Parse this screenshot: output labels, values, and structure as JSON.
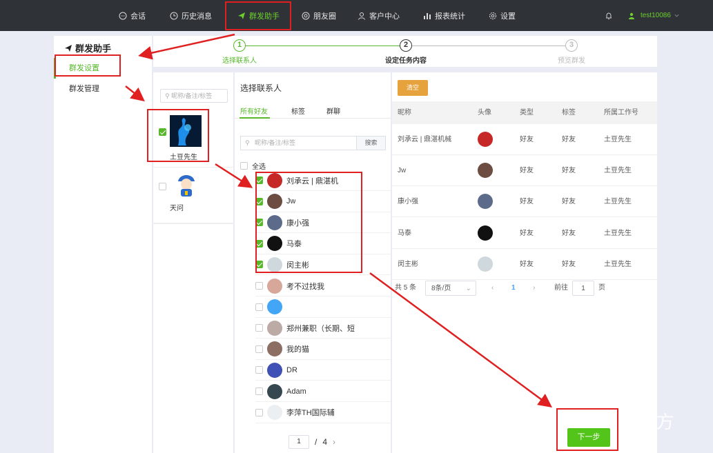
{
  "topnav": {
    "items": [
      {
        "label": "会话",
        "icon": "chat-icon"
      },
      {
        "label": "历史消息",
        "icon": "clock-icon"
      },
      {
        "label": "群发助手",
        "icon": "send-icon",
        "active": true
      },
      {
        "label": "朋友圈",
        "icon": "moments-icon"
      },
      {
        "label": "客户中心",
        "icon": "user-icon"
      },
      {
        "label": "报表统计",
        "icon": "bar-chart-icon"
      },
      {
        "label": "设置",
        "icon": "gear-icon"
      }
    ],
    "username": "test10086"
  },
  "sidebar": {
    "title": "群发助手",
    "items": [
      {
        "label": "群发设置",
        "active": true
      },
      {
        "label": "群发管理"
      }
    ]
  },
  "steps": [
    {
      "num": "1",
      "label": "选择联系人",
      "state": "done"
    },
    {
      "num": "2",
      "label": "设定任务内容",
      "state": "current"
    },
    {
      "num": "3",
      "label": "预览群发",
      "state": "pending"
    }
  ],
  "accounts": {
    "search_placeholder": "昵称/备注/标签",
    "items": [
      {
        "name": "土豆先生",
        "checked": true
      },
      {
        "name": "天问",
        "checked": false
      }
    ]
  },
  "contacts": {
    "header": "选择联系人",
    "tabs": [
      "所有好友",
      "标签",
      "群聊"
    ],
    "search_placeholder": "昵称/备注/标签",
    "search_button": "搜索",
    "select_all": "全选",
    "items": [
      {
        "name": "刘承云 | 鼎湛机",
        "checked": true
      },
      {
        "name": "Jw",
        "checked": true
      },
      {
        "name": "康小强",
        "checked": true
      },
      {
        "name": "马泰",
        "checked": true
      },
      {
        "name": "闵主彬",
        "checked": true
      },
      {
        "name": "考不过找我",
        "checked": false
      },
      {
        "name": "",
        "checked": false
      },
      {
        "name": "郑州兼职（长期、短",
        "checked": false
      },
      {
        "name": "我的猫",
        "checked": false
      },
      {
        "name": "DR",
        "checked": false
      },
      {
        "name": "Adam",
        "checked": false
      },
      {
        "name": "李萍TH国际辅",
        "checked": false
      }
    ],
    "pager": {
      "page": "1",
      "sep": "/",
      "total": "4"
    }
  },
  "selected": {
    "clear_button": "清空",
    "columns": [
      "昵称",
      "头像",
      "类型",
      "标签",
      "所属工作号"
    ],
    "rows": [
      {
        "nick": "刘承云 | 鼎湛机械",
        "type": "好友",
        "tag": "好友",
        "owner": "土豆先生"
      },
      {
        "nick": "Jw",
        "type": "好友",
        "tag": "好友",
        "owner": "土豆先生"
      },
      {
        "nick": "康小强",
        "type": "好友",
        "tag": "好友",
        "owner": "土豆先生"
      },
      {
        "nick": "马泰",
        "type": "好友",
        "tag": "好友",
        "owner": "土豆先生"
      },
      {
        "nick": "闵主彬",
        "type": "好友",
        "tag": "好友",
        "owner": "土豆先生"
      }
    ],
    "pager": {
      "total": "共 5 条",
      "page_size": "8条/页",
      "current": "1",
      "goto_label": "前往",
      "goto_value": "1",
      "page_suffix": "页"
    }
  },
  "next_button": "下一步",
  "watermark": "知乎 @心系远方",
  "colors": {
    "accent": "#57b92a",
    "nav_bg": "#2f3338",
    "clear": "#e6a23c",
    "annotation": "#e02020"
  }
}
